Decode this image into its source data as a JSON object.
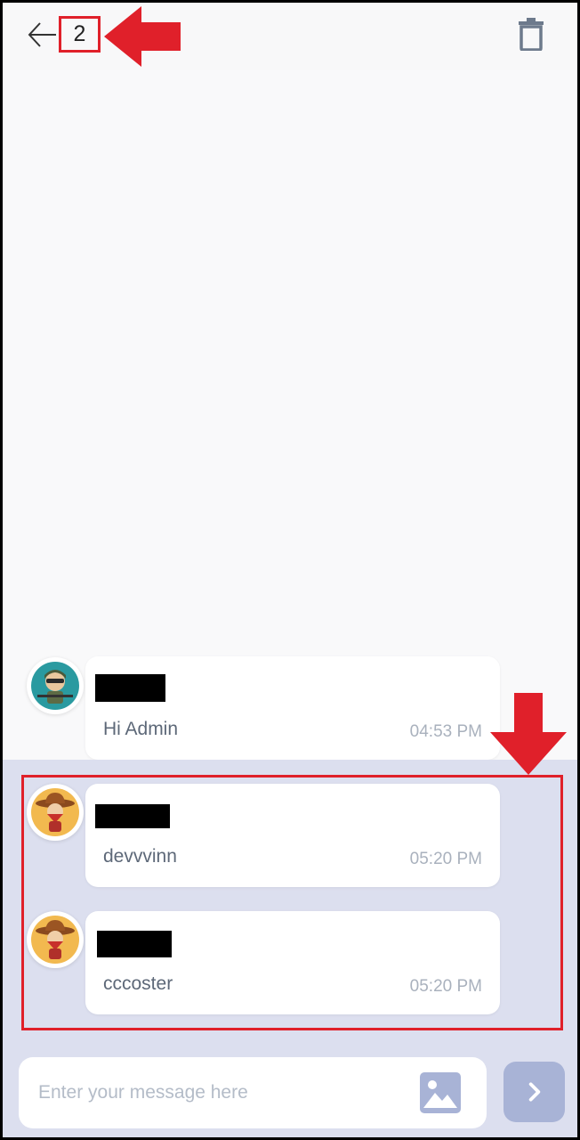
{
  "header": {
    "selected_count": "2"
  },
  "messages": [
    {
      "text": "Hi Admin",
      "time": "04:53 PM",
      "selected": false
    },
    {
      "text": "devvvinn",
      "time": "05:20 PM",
      "selected": true
    },
    {
      "text": "cccoster",
      "time": "05:20 PM",
      "selected": true
    }
  ],
  "composer": {
    "placeholder": "Enter your message here"
  },
  "colors": {
    "annotation_red": "#e0202a",
    "selected_background": "#dcdfef",
    "send_button": "#a8b3d6"
  }
}
